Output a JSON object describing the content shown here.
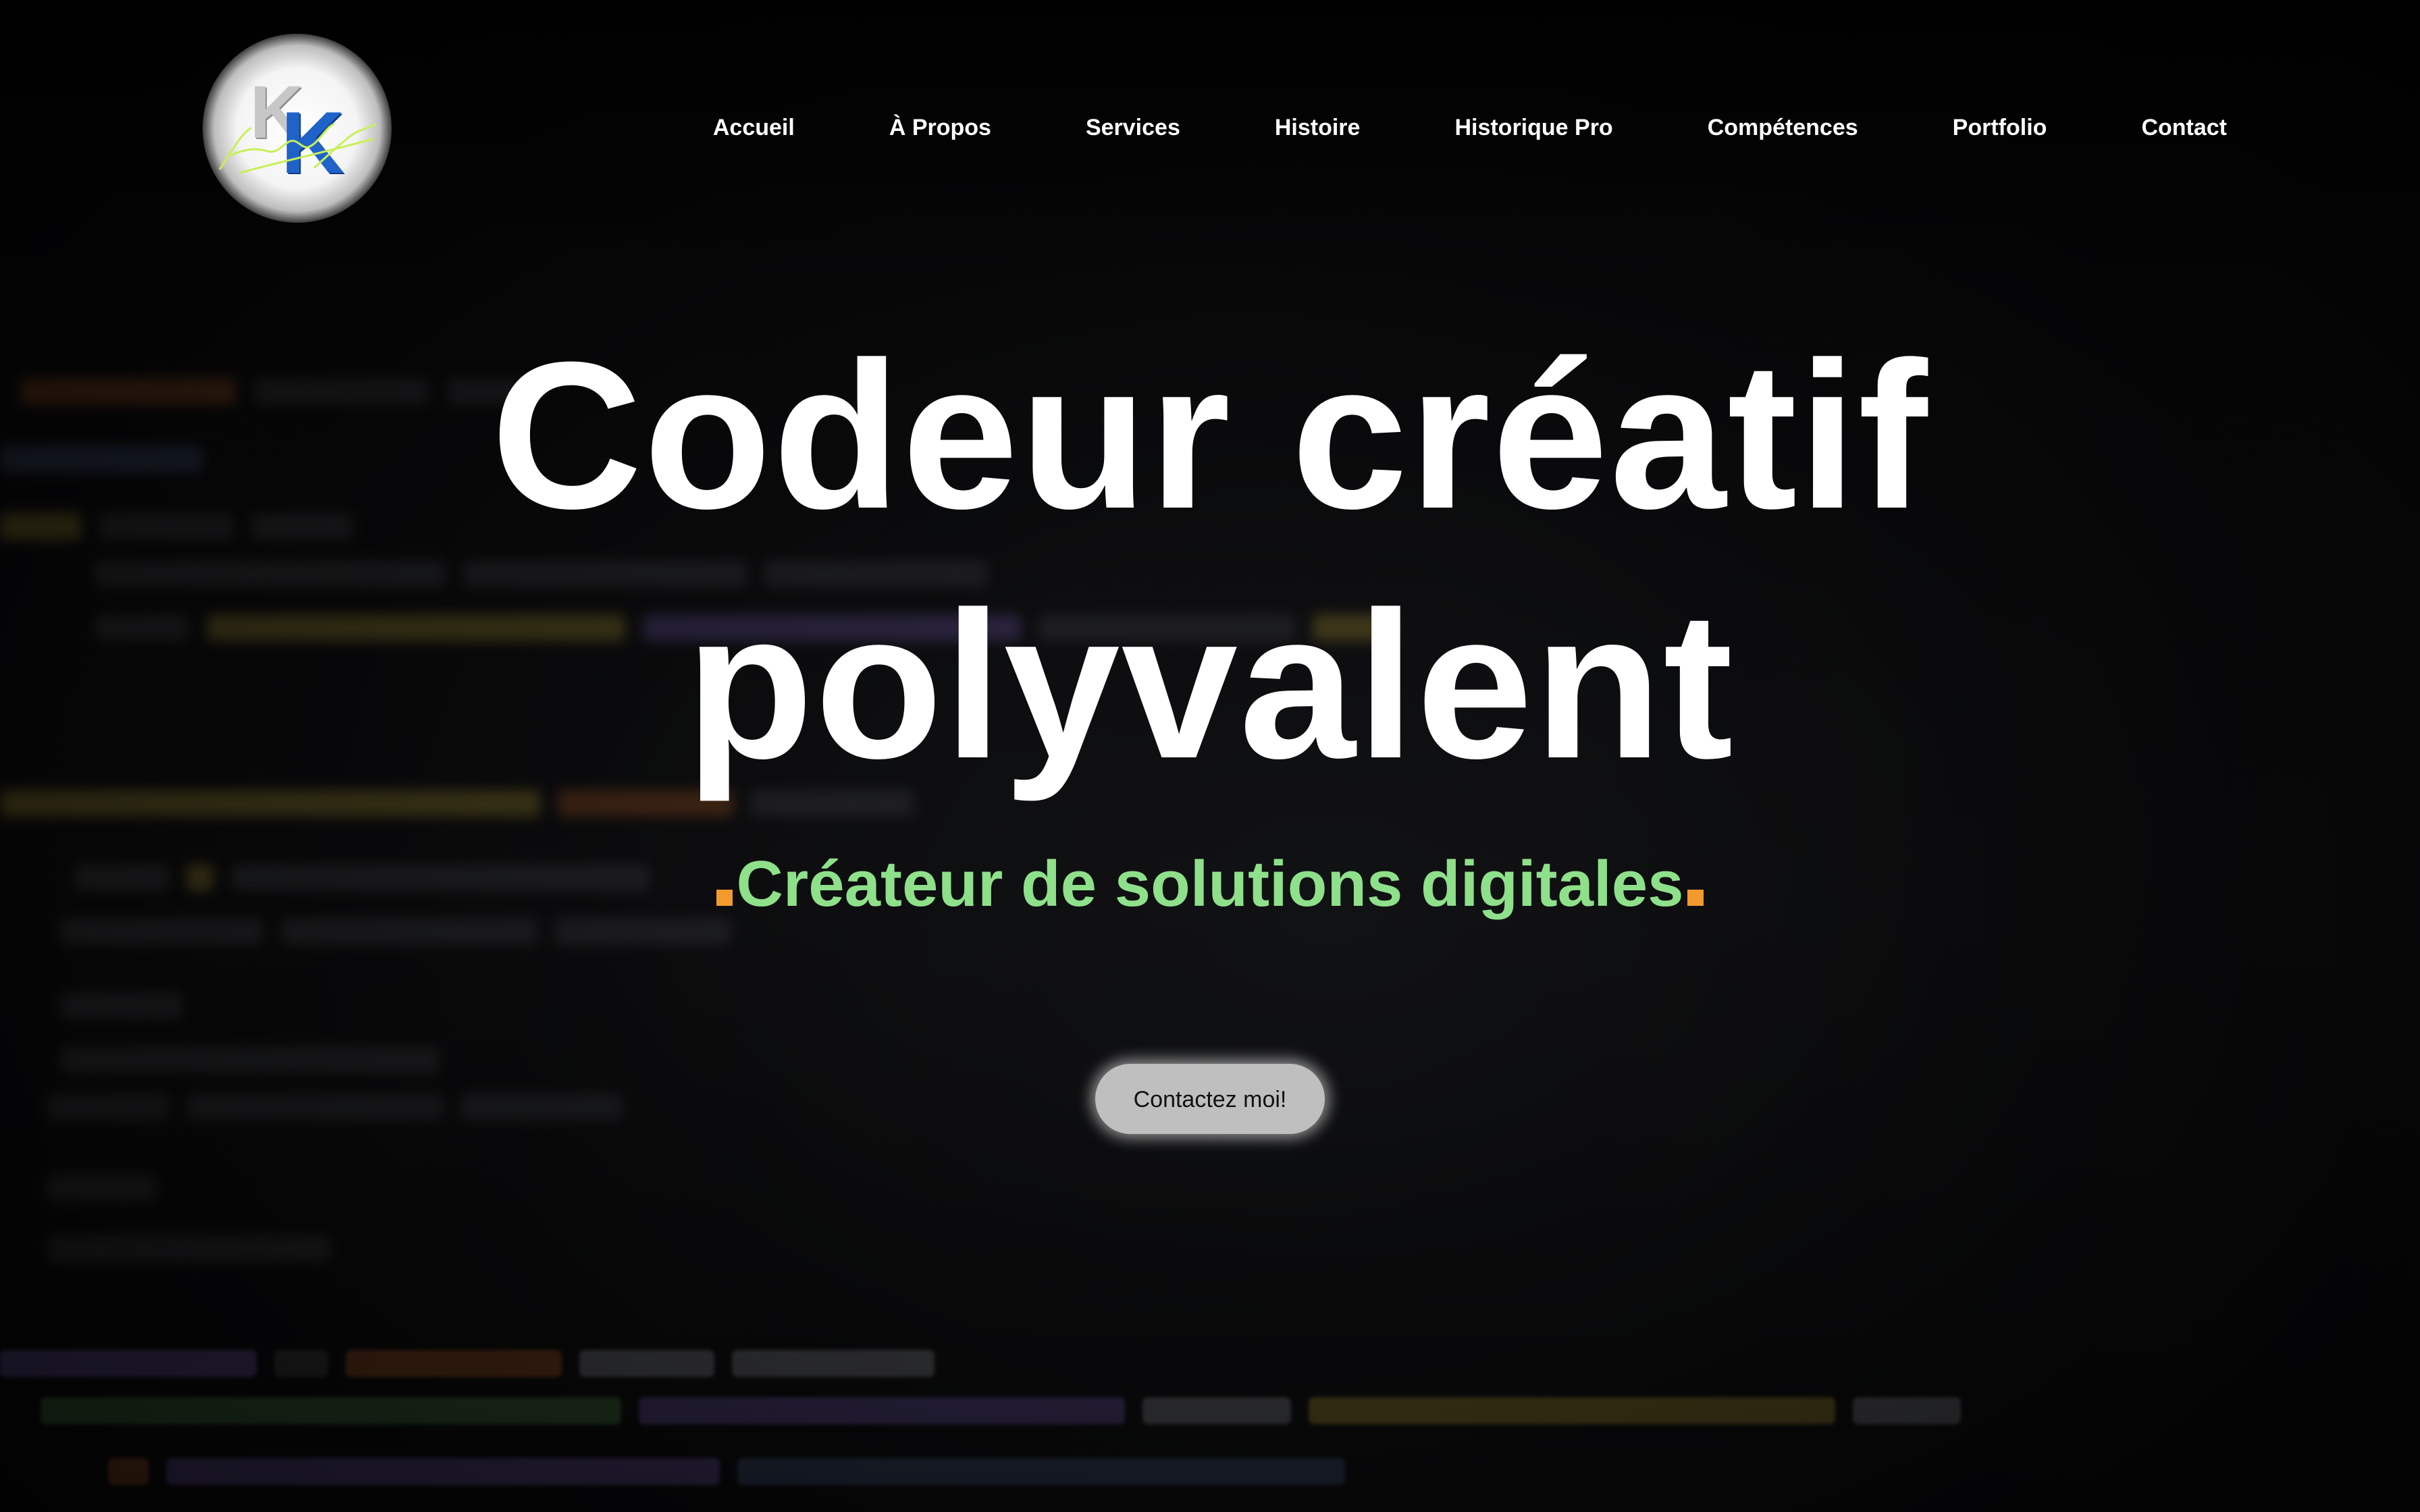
{
  "logo": {
    "letters": [
      "K",
      "K"
    ],
    "script_text": "Kamal Khatim",
    "colors": {
      "letter_back": "#c7c7c7",
      "letter_front": "#1f63c9",
      "script": "#c7f05a"
    }
  },
  "nav": {
    "items": [
      {
        "label": "Accueil"
      },
      {
        "label": "À Propos"
      },
      {
        "label": "Services"
      },
      {
        "label": "Histoire"
      },
      {
        "label": "Historique Pro"
      },
      {
        "label": "Compétences"
      },
      {
        "label": "Portfolio"
      },
      {
        "label": "Contact"
      }
    ]
  },
  "hero": {
    "title": "Codeur créatif polyvalent",
    "subtitle": "Créateur de solutions digitales",
    "cta_label": "Contactez moi!"
  },
  "colors": {
    "title": "#ffffff",
    "subtitle": "#8fe08a",
    "accent_dot": "#f29a2e",
    "cta_background": "#bfbfbf",
    "background": "#0b0b0c"
  }
}
